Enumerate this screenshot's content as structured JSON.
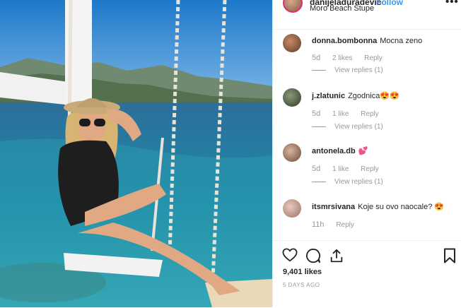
{
  "header": {
    "username": "danijeladuradevic",
    "follow_label": "Follow",
    "location": "Moro Beach Stupe",
    "more_label": "•••"
  },
  "comments": [
    {
      "user": "donna.bombonna",
      "text": "Mocna zeno",
      "time": "5d",
      "likes": "2 likes",
      "reply": "Reply",
      "view_replies": "View replies (1)"
    },
    {
      "user": "j.zlatunic",
      "text": "Zgodnica😍😍",
      "time": "5d",
      "likes": "1 like",
      "reply": "Reply",
      "view_replies": "View replies (1)"
    },
    {
      "user": "antonela.db",
      "text": "💕",
      "time": "5d",
      "likes": "1 like",
      "reply": "Reply",
      "view_replies": "View replies (1)"
    },
    {
      "user": "itsmrsivana",
      "text": "Koje su ovo naocale? 😍",
      "time": "11h",
      "reply": "Reply"
    }
  ],
  "post": {
    "likes": "9,401 likes",
    "posted": "5 DAYS AGO"
  },
  "icons": [
    "heart-icon",
    "comment-icon",
    "share-icon",
    "bookmark-icon"
  ]
}
